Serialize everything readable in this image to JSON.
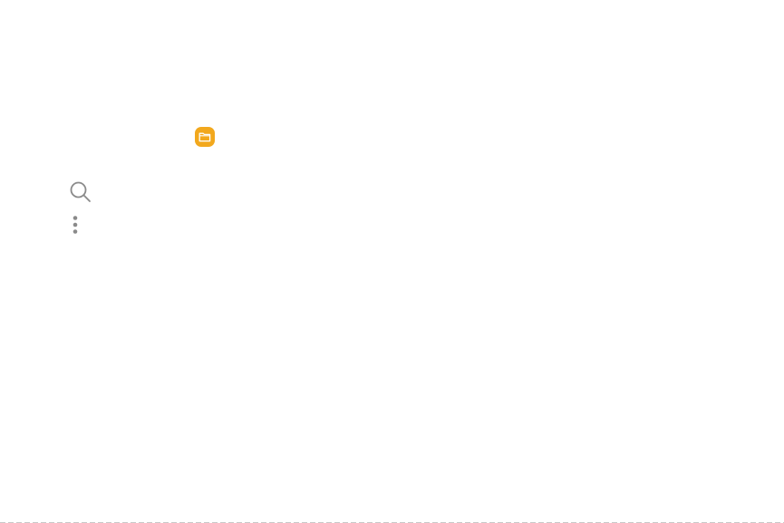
{
  "icons": {
    "folder_app": "folder-icon",
    "search": "search-icon",
    "more_options": "more-vertical-icon"
  },
  "colors": {
    "folder_badge": "#f2a81d",
    "icon_stroke": "#8a8a8a",
    "background": "#ffffff"
  }
}
